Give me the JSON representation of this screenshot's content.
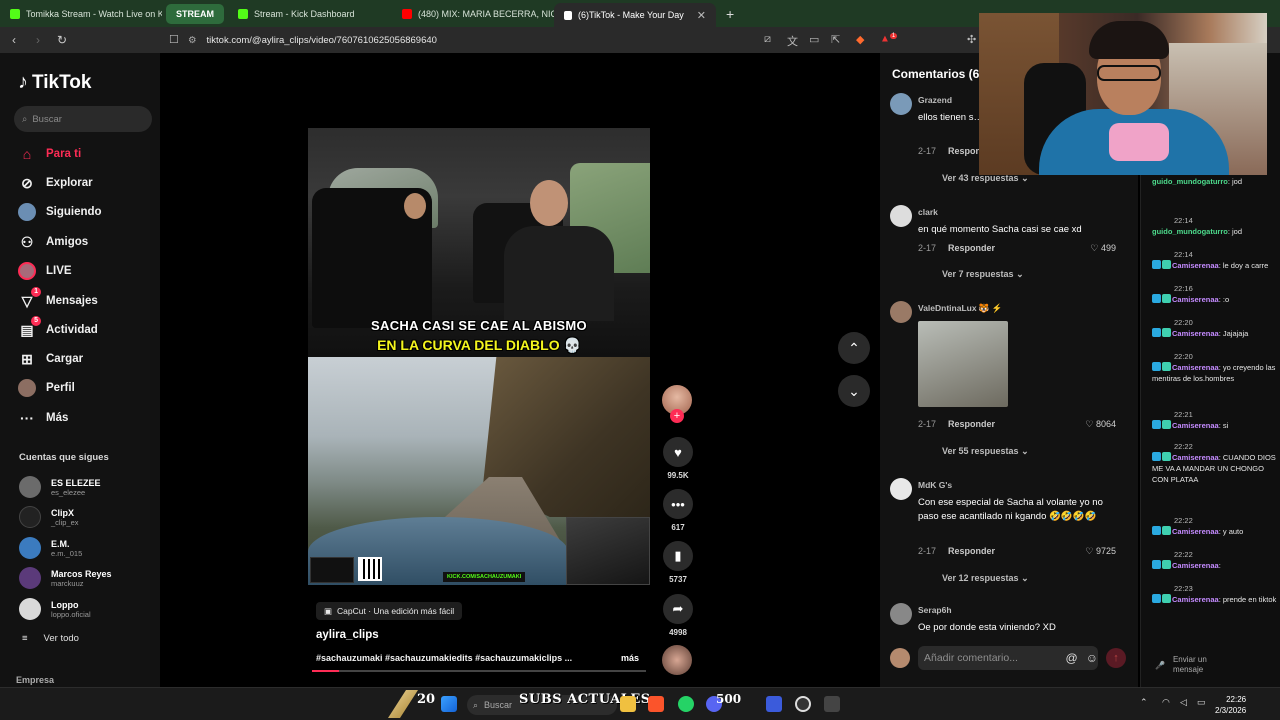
{
  "browser": {
    "tabs": [
      {
        "label": "Tomikka Stream - Watch Live on Kick",
        "favicon_color": "#53fc18"
      },
      {
        "label": "STREAM",
        "favicon_color": ""
      },
      {
        "label": "Stream - Kick Dashboard",
        "favicon_color": "#53fc18"
      },
      {
        "label": "(480) MIX: MARIA BECERRA, NICKI NICOLE",
        "favicon_color": "#ff0000"
      },
      {
        "label": "(6)TikTok - Make Your Day",
        "favicon_color": "#ffffff"
      }
    ],
    "active_tab_close": "✕",
    "new_tab": "+",
    "url": "tiktok.com/@aylira_clips/video/7607610625056869640",
    "extension_badge": "1"
  },
  "sidebar": {
    "logo": "TikTok",
    "search_placeholder": "Buscar",
    "nav": [
      {
        "label": "Para ti",
        "icon": "home-icon",
        "active": true
      },
      {
        "label": "Explorar",
        "icon": "compass-icon"
      },
      {
        "label": "Siguiendo",
        "icon": "following-avatar-icon"
      },
      {
        "label": "Amigos",
        "icon": "friends-icon"
      },
      {
        "label": "LIVE",
        "icon": "live-icon"
      },
      {
        "label": "Mensajes",
        "icon": "messages-icon",
        "badge": "1"
      },
      {
        "label": "Actividad",
        "icon": "activity-icon",
        "badge": "5"
      },
      {
        "label": "Cargar",
        "icon": "upload-icon"
      },
      {
        "label": "Perfil",
        "icon": "profile-icon"
      },
      {
        "label": "Más",
        "icon": "more-icon"
      }
    ],
    "following_title": "Cuentas que sigues",
    "accounts": [
      {
        "name": "ES ELEZEE",
        "handle": "es_elezee",
        "color": "#6b6b6b"
      },
      {
        "name": "ClipX",
        "handle": "_clip_ex",
        "color": "#222222"
      },
      {
        "name": "E.M.",
        "handle": "e.m._015",
        "color": "#3b7bbf"
      },
      {
        "name": "Marcos Reyes",
        "handle": "marckuuz",
        "color": "#5b3a7a"
      },
      {
        "name": "Loppo",
        "handle": "loppo.oficial",
        "color": "#d9d9d9"
      }
    ],
    "see_all": "Ver todo",
    "empresa": "Empresa"
  },
  "video": {
    "caption_line1": "SACHA CASI SE CAE AL ABISMO",
    "caption_line2": "EN LA CURVA DEL DIABLO 💀",
    "kick_tag": "KICK.COM/SACHAUZUMAKI",
    "capcut": "CapCut · Una edición más fácil",
    "author": "aylira_clips",
    "hashtags": "#sachauzumaki #sachauzumakiedits #sachauzumakiclips ...",
    "more": "más",
    "progress": 0.08,
    "likes": "99.5K",
    "comments": "617",
    "saves": "5737",
    "shares": "4998"
  },
  "comments": {
    "title": "Comentarios (617)",
    "items": [
      {
        "user": "Grazend",
        "text": "ellos tienen s… tienen señal c…",
        "date": "2-17",
        "reply": "Responder",
        "likes": "",
        "replies": "Ver 43 respuestas",
        "avatar": "#7a9ab8"
      },
      {
        "user": "clark",
        "text": "en qué momento Sacha casi se cae xd",
        "date": "2-17",
        "reply": "Responder",
        "likes": "499",
        "replies": "Ver 7 respuestas",
        "avatar": "#dddddd"
      },
      {
        "user": "ValeDntinaLux 🐯 ⚡",
        "text": "",
        "date": "2-17",
        "reply": "Responder",
        "likes": "8064",
        "replies": "Ver 55 respuestas",
        "avatar": "#9a7a66"
      },
      {
        "user": "MdK G's",
        "text": "Con ese especial de Sacha al volante yo no paso ese acantilado ni kgando 🤣🤣🤣🤣",
        "date": "2-17",
        "reply": "Responder",
        "likes": "9725",
        "replies": "Ver 12 respuestas",
        "avatar": "#e8e8e8"
      },
      {
        "user": "Serap6h",
        "text": "Oe por donde esta viniendo? XD",
        "date": "",
        "reply": "",
        "likes": "",
        "replies": "",
        "avatar": "#888888"
      }
    ],
    "input_placeholder": "Añadir comentario...",
    "at_icon": "@",
    "emoji_icon": "☺"
  },
  "chat": {
    "lines": [
      {
        "time": "",
        "user": "guido_mundogaturro",
        "msg": ": jod",
        "color": "#4ddb8c"
      },
      {
        "time": "22:14",
        "user": "guido_mundogaturro",
        "msg": ": jod",
        "color": "#4ddb8c"
      },
      {
        "time": "22:14",
        "user": "Camiserenaa",
        "msg": ": le doy a carre",
        "color": "#c48bff"
      },
      {
        "time": "22:16",
        "user": "Camiserenaa",
        "msg": ": :o",
        "color": "#c48bff"
      },
      {
        "time": "22:20",
        "user": "Camiserenaa",
        "msg": ": Jajajaja",
        "color": "#c48bff"
      },
      {
        "time": "22:20",
        "user": "Camiserenaa",
        "msg": ": yo creyendo las mentiras de los.hombres",
        "color": "#c48bff"
      },
      {
        "time": "22:21",
        "user": "Camiserenaa",
        "msg": ": si",
        "color": "#c48bff"
      },
      {
        "time": "22:22",
        "user": "Camiserenaa",
        "msg": ": CUANDO DIOS ME VA A MANDAR UN CHONGO CON PLATAA",
        "color": "#c48bff"
      },
      {
        "time": "22:22",
        "user": "Camiserenaa",
        "msg": ": y auto",
        "color": "#c48bff"
      },
      {
        "time": "22:22",
        "user": "Camiserenaa",
        "msg": ":",
        "color": "#c48bff"
      },
      {
        "time": "22:23",
        "user": "Camiserenaa",
        "msg": ": prende en tiktok",
        "color": "#c48bff"
      }
    ],
    "send_label": "Enviar un mensaje"
  },
  "taskbar": {
    "subs_count": "20",
    "subs_label": "SUBS ACTUALES",
    "search": "Buscar",
    "goal": "500",
    "time": "22:26",
    "date": "2/3/2026"
  }
}
